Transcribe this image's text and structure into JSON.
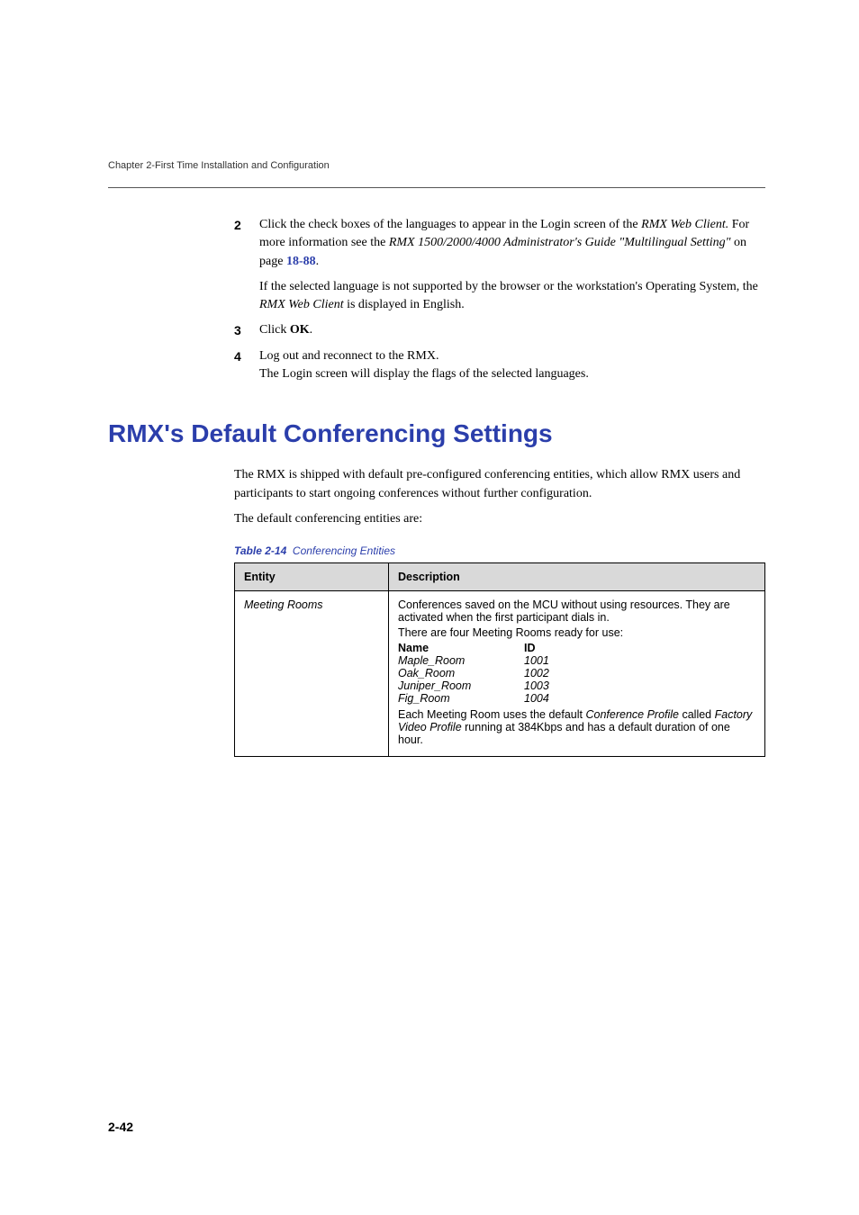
{
  "runningHead": "Chapter 2-First Time Installation and Configuration",
  "steps": {
    "s2": {
      "num": "2",
      "text_a": "Click the check boxes of the languages to appear in the Login screen of the ",
      "text_b_italic": "RMX Web Client.",
      "text_c": " For more information see the ",
      "text_d_italic": "RMX 1500/2000/4000 Administrator's Guide \"Multilingual Setting\"",
      "text_e": " on page ",
      "text_f_link": "18-88",
      "text_g": ".",
      "sub_a": "If the selected language is not supported by the browser or the workstation's Operating System, the ",
      "sub_b_italic": "RMX Web Client",
      "sub_c": " is displayed in English."
    },
    "s3": {
      "num": "3",
      "text_a": "Click ",
      "text_b_bold": "OK",
      "text_c": "."
    },
    "s4": {
      "num": "4",
      "text_a": "Log out and reconnect to the RMX.",
      "sub": "The Login screen will display the flags of the selected languages."
    }
  },
  "h1": "RMX's Default Conferencing Settings",
  "para1": "The RMX is shipped with default pre-configured conferencing entities, which allow RMX users and participants to start ongoing conferences without further configuration.",
  "para2": "The default conferencing entities are:",
  "tableCaption": {
    "title": "Table 2-14",
    "text": "Conferencing Entities"
  },
  "table": {
    "head": {
      "c1": "Entity",
      "c2": "Description"
    },
    "row1": {
      "entity": "Meeting Rooms",
      "d1": "Conferences saved on the MCU without using resources. They are activated when the first participant dials in.",
      "d2": "There are four Meeting Rooms ready for use:",
      "h_name": "Name",
      "h_id": "ID",
      "rooms": [
        {
          "name": "Maple_Room",
          "id": "1001"
        },
        {
          "name": "Oak_Room",
          "id": "1002"
        },
        {
          "name": "Juniper_Room",
          "id": "1003"
        },
        {
          "name": "Fig_Room",
          "id": "1004"
        }
      ],
      "d3_a": "Each Meeting Room uses the default ",
      "d3_b_italic": "Conference Profile",
      "d3_c": " called ",
      "d3_d_italic": "Factory Video Profile",
      "d3_e": " running at 384Kbps and has a default duration of one hour."
    }
  },
  "pageNum": "2-42"
}
